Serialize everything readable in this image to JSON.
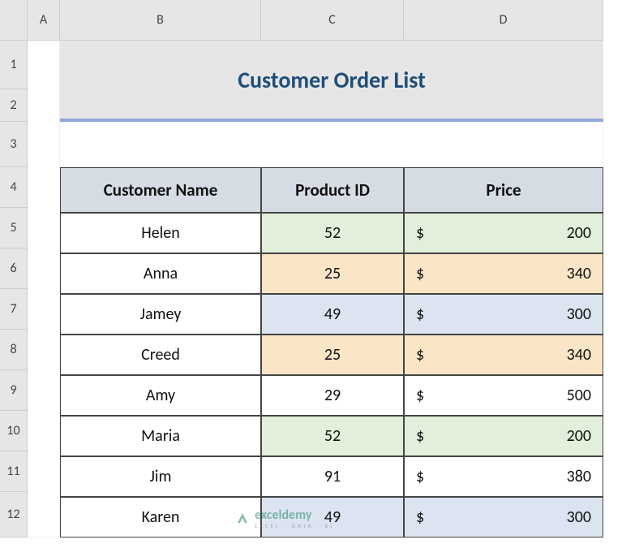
{
  "columns": [
    "A",
    "B",
    "C",
    "D"
  ],
  "rows": [
    "1",
    "2",
    "3",
    "4",
    "5",
    "6",
    "7",
    "8",
    "9",
    "10",
    "11",
    "12"
  ],
  "title": "Customer Order List",
  "headers": {
    "name": "Customer Name",
    "pid": "Product ID",
    "price": "Price"
  },
  "currency": "$",
  "orders": [
    {
      "name": "Helen",
      "pid": "52",
      "price": "200",
      "color": "green"
    },
    {
      "name": "Anna",
      "pid": "25",
      "price": "340",
      "color": "yellow"
    },
    {
      "name": "Jamey",
      "pid": "49",
      "price": "300",
      "color": "blue"
    },
    {
      "name": "Creed",
      "pid": "25",
      "price": "340",
      "color": "yellow"
    },
    {
      "name": "Amy",
      "pid": "29",
      "price": "500",
      "color": ""
    },
    {
      "name": "Maria",
      "pid": "52",
      "price": "200",
      "color": "green"
    },
    {
      "name": "Jim",
      "pid": "91",
      "price": "380",
      "color": ""
    },
    {
      "name": "Karen",
      "pid": "49",
      "price": "300",
      "color": "blue"
    }
  ],
  "watermark": {
    "name": "exceldemy",
    "sub": "EXCEL · DATA · BI"
  },
  "chart_data": {
    "type": "table",
    "title": "Customer Order List",
    "columns": [
      "Customer Name",
      "Product ID",
      "Price"
    ],
    "rows": [
      [
        "Helen",
        52,
        200
      ],
      [
        "Anna",
        25,
        340
      ],
      [
        "Jamey",
        49,
        300
      ],
      [
        "Creed",
        25,
        340
      ],
      [
        "Amy",
        29,
        500
      ],
      [
        "Maria",
        52,
        200
      ],
      [
        "Jim",
        91,
        380
      ],
      [
        "Karen",
        49,
        300
      ]
    ],
    "highlight_groups": {
      "green": [
        1,
        6
      ],
      "yellow": [
        2,
        4
      ],
      "blue": [
        3,
        8
      ]
    }
  }
}
